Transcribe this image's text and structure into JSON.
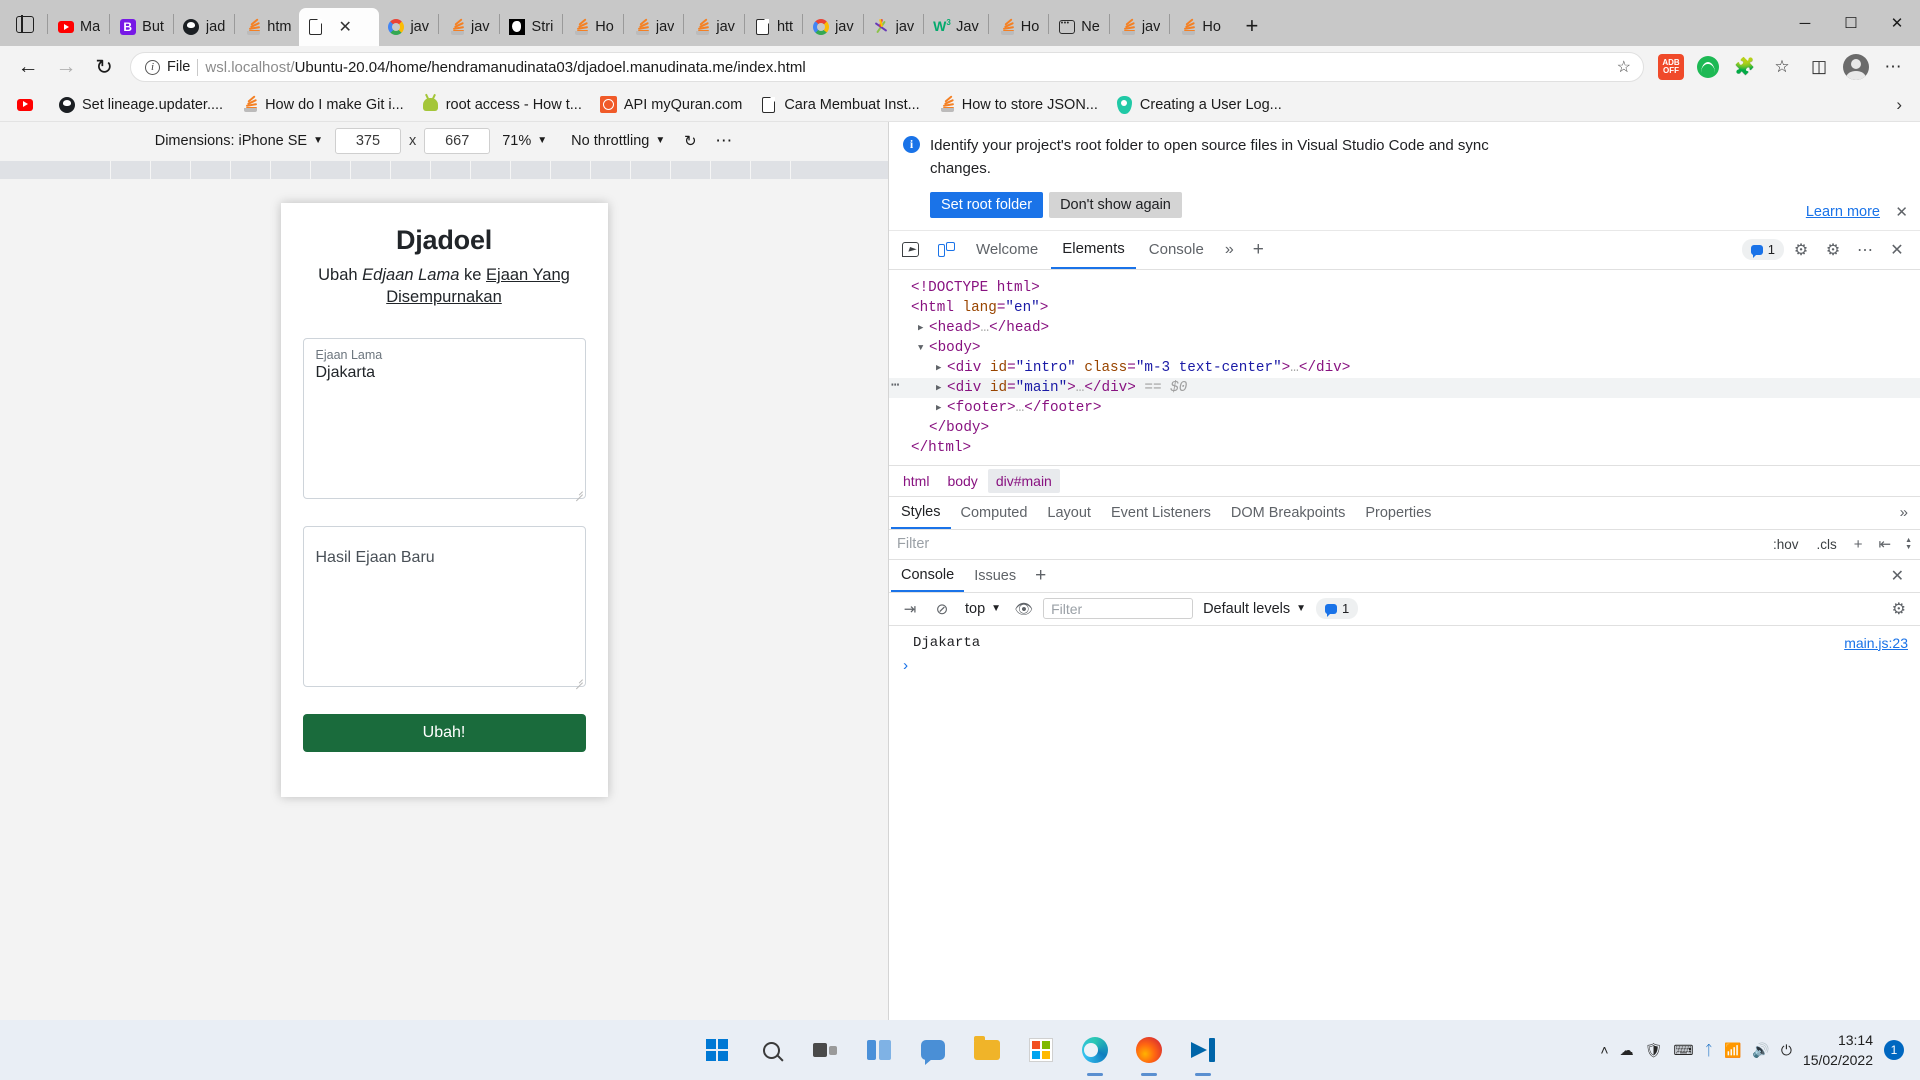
{
  "browser": {
    "sidebar_icon": "sidebar-icon",
    "tabs": [
      {
        "label": "Ma",
        "icon": "youtube-icon",
        "active": false
      },
      {
        "label": "But",
        "icon": "b-purple-icon",
        "active": false
      },
      {
        "label": "jad",
        "icon": "github-icon",
        "active": false
      },
      {
        "label": "htm",
        "icon": "stackoverflow-icon",
        "active": false
      },
      {
        "label": "",
        "icon": "document-icon",
        "active": true
      },
      {
        "label": "jav",
        "icon": "google-icon",
        "active": false
      },
      {
        "label": "jav",
        "icon": "stackoverflow-icon",
        "active": false
      },
      {
        "label": "Stri",
        "icon": "stripe-black-icon",
        "active": false
      },
      {
        "label": "Ho",
        "icon": "stackoverflow-icon",
        "active": false
      },
      {
        "label": "jav",
        "icon": "stackoverflow-icon",
        "active": false
      },
      {
        "label": "jav",
        "icon": "stackoverflow-icon",
        "active": false
      },
      {
        "label": "htt",
        "icon": "document-icon",
        "active": false
      },
      {
        "label": "jav",
        "icon": "google-icon",
        "active": false
      },
      {
        "label": "jav",
        "icon": "jsfiddle-icon",
        "active": false
      },
      {
        "label": "Jav",
        "icon": "w3schools-icon",
        "active": false
      },
      {
        "label": "Ho",
        "icon": "stackoverflow-icon",
        "active": false
      },
      {
        "label": "Ne",
        "icon": "news-icon",
        "active": false
      },
      {
        "label": "jav",
        "icon": "stackoverflow-icon",
        "active": false
      },
      {
        "label": "Ho",
        "icon": "stackoverflow-icon",
        "active": false
      }
    ],
    "new_tab_label": "+",
    "window_controls": {
      "minimize": "─",
      "maximize": "☐",
      "close": "✕"
    },
    "nav": {
      "back": "←",
      "forward": "→",
      "refresh": "↻"
    },
    "omnibox": {
      "scheme_label": "File",
      "url_prefix": "wsl.localhost/",
      "url_highlight": "Ubuntu-20.04/home/hendramanudinata03/djadoel.manudinata.me/index.html",
      "full_url": "wsl.localhost/Ubuntu-20.04/home/hendramanudinata03/djadoel.manudinata.me/index.html",
      "favorite_icon": "star-add-icon"
    },
    "toolbar_right": [
      {
        "name": "adblock-icon",
        "label": "OFF"
      },
      {
        "name": "spotify-icon"
      },
      {
        "name": "extensions-icon"
      },
      {
        "name": "favorites-icon"
      },
      {
        "name": "collections-icon"
      },
      {
        "name": "profile-avatar"
      },
      {
        "name": "settings-more-icon"
      }
    ],
    "bookmarks": [
      {
        "label": "",
        "icon": "youtube-icon"
      },
      {
        "label": "Set lineage.updater....",
        "icon": "github-icon"
      },
      {
        "label": "How do I make Git i...",
        "icon": "stackoverflow-icon"
      },
      {
        "label": "root access - How t...",
        "icon": "android-icon"
      },
      {
        "label": "API myQuran.com",
        "icon": "quran-icon"
      },
      {
        "label": "Cara Membuat Inst...",
        "icon": "document-icon"
      },
      {
        "label": "How to store JSON...",
        "icon": "stackoverflow-icon"
      },
      {
        "label": "Creating a User Log...",
        "icon": "teal-pin-icon"
      }
    ],
    "bookmarks_overflow": "›"
  },
  "device_toolbar": {
    "dimensions_label": "Dimensions: iPhone SE",
    "width": "375",
    "height": "667",
    "multiply": "x",
    "zoom": "71%",
    "throttling": "No throttling",
    "rotate_icon": "rotate-device-icon",
    "more_icon": "more-options-icon",
    "caret": "▼"
  },
  "page": {
    "title": "Djadoel",
    "subtitle_prefix": "Ubah ",
    "subtitle_italic": "Edjaan Lama",
    "subtitle_mid": " ke ",
    "subtitle_link": "Ejaan Yang Disempurnakan",
    "input_label": "Ejaan Lama",
    "input_value": "Djakarta",
    "output_placeholder": "Hasil Ejaan Baru",
    "submit_label": "Ubah!",
    "accent_color": "#1a6b3c"
  },
  "devtools": {
    "banner": {
      "text": "Identify your project's root folder to open source files in Visual Studio Code and sync changes.",
      "primary_button": "Set root folder",
      "secondary_button": "Don't show again",
      "learn_more": "Learn more",
      "close_icon": "close-icon",
      "info_icon": "info-icon"
    },
    "tabs": {
      "inspect_icon": "inspect-element-icon",
      "device_icon": "device-emulation-icon",
      "items": [
        {
          "label": "Welcome",
          "active": false
        },
        {
          "label": "Elements",
          "active": true
        },
        {
          "label": "Console",
          "active": false
        }
      ],
      "more": "»",
      "add": "+",
      "issue_count": "1",
      "settings_icon": "settings-gear-icon",
      "customize_icon": "customize-icon",
      "more_icon": "more-tools-icon",
      "close_icon": "close-devtools-icon"
    },
    "dom": [
      {
        "indent": 0,
        "arrow": "",
        "parts": [
          {
            "t": "<!DOCTYPE html>",
            "c": "tg"
          }
        ]
      },
      {
        "indent": 0,
        "arrow": "",
        "parts": [
          {
            "t": "<html ",
            "c": "tg"
          },
          {
            "t": "lang",
            "c": "at"
          },
          {
            "t": "=",
            "c": "tg"
          },
          {
            "t": "\"en\"",
            "c": "va"
          },
          {
            "t": ">",
            "c": "tg"
          }
        ]
      },
      {
        "indent": 1,
        "arrow": "▶",
        "parts": [
          {
            "t": "<head>",
            "c": "tg"
          },
          {
            "t": "…",
            "c": "gy"
          },
          {
            "t": "</head>",
            "c": "tg"
          }
        ]
      },
      {
        "indent": 1,
        "arrow": "▼",
        "parts": [
          {
            "t": "<body>",
            "c": "tg"
          }
        ]
      },
      {
        "indent": 2,
        "arrow": "▶",
        "parts": [
          {
            "t": "<div ",
            "c": "tg"
          },
          {
            "t": "id",
            "c": "at"
          },
          {
            "t": "=",
            "c": "tg"
          },
          {
            "t": "\"intro\"",
            "c": "va"
          },
          {
            "t": " class",
            "c": "at"
          },
          {
            "t": "=",
            "c": "tg"
          },
          {
            "t": "\"m-3 text-center\"",
            "c": "va"
          },
          {
            "t": ">",
            "c": "tg"
          },
          {
            "t": "…",
            "c": "gy"
          },
          {
            "t": "</div>",
            "c": "tg"
          }
        ]
      },
      {
        "indent": 2,
        "arrow": "▶",
        "selected": true,
        "dots": "⋯",
        "parts": [
          {
            "t": "<div ",
            "c": "tg"
          },
          {
            "t": "id",
            "c": "at"
          },
          {
            "t": "=",
            "c": "tg"
          },
          {
            "t": "\"main\"",
            "c": "va"
          },
          {
            "t": ">",
            "c": "tg"
          },
          {
            "t": "…",
            "c": "gy"
          },
          {
            "t": "</div>",
            "c": "tg"
          },
          {
            "t": "  == $0",
            "c": "sel-dollar"
          }
        ]
      },
      {
        "indent": 2,
        "arrow": "▶",
        "parts": [
          {
            "t": "<footer>",
            "c": "tg"
          },
          {
            "t": "…",
            "c": "gy"
          },
          {
            "t": "</footer>",
            "c": "tg"
          }
        ]
      },
      {
        "indent": 1,
        "arrow": "",
        "parts": [
          {
            "t": "</body>",
            "c": "tg"
          }
        ]
      },
      {
        "indent": 0,
        "arrow": "",
        "parts": [
          {
            "t": "</html>",
            "c": "tg"
          }
        ]
      }
    ],
    "breadcrumb": [
      {
        "label": "html",
        "active": false
      },
      {
        "label": "body",
        "active": false
      },
      {
        "label": "div#main",
        "active": true
      }
    ],
    "styles_tabs": [
      {
        "label": "Styles",
        "active": true
      },
      {
        "label": "Computed",
        "active": false
      },
      {
        "label": "Layout",
        "active": false
      },
      {
        "label": "Event Listeners",
        "active": false
      },
      {
        "label": "DOM Breakpoints",
        "active": false
      },
      {
        "label": "Properties",
        "active": false
      }
    ],
    "styles_more": "»",
    "styles_filter": {
      "placeholder": "Filter",
      "hov": ":hov",
      "cls": ".cls",
      "new_rule": "+",
      "toggle_icon": "toggle-element-state-icon"
    },
    "console_tabs": [
      {
        "label": "Console",
        "active": true
      },
      {
        "label": "Issues",
        "active": false
      }
    ],
    "console_add": "+",
    "console_close_icon": "close-icon",
    "console_toolbar": {
      "sidebar_icon": "console-sidebar-icon",
      "clear_icon": "clear-console-icon",
      "context": "top",
      "eye_icon": "live-expression-icon",
      "filter_placeholder": "Filter",
      "levels": "Default levels",
      "issue_count": "1",
      "settings_icon": "console-settings-icon",
      "caret": "▼"
    },
    "console_output": [
      {
        "message": "Djakarta",
        "source": "main.js:23"
      }
    ],
    "console_prompt": "›"
  },
  "taskbar": {
    "apps": [
      {
        "name": "start-button",
        "running": false
      },
      {
        "name": "search-button",
        "running": false
      },
      {
        "name": "task-view-button",
        "running": false
      },
      {
        "name": "widgets-button",
        "running": false
      },
      {
        "name": "chat-button",
        "running": false
      },
      {
        "name": "file-explorer",
        "running": false
      },
      {
        "name": "microsoft-store",
        "running": false
      },
      {
        "name": "microsoft-edge",
        "running": true
      },
      {
        "name": "firefox",
        "running": true
      },
      {
        "name": "visual-studio-code",
        "running": true
      }
    ],
    "tray": [
      "show-hidden-icons",
      "onedrive-icon",
      "security-icon",
      "keyboard-icon",
      "bluetooth-icon",
      "wifi-icon",
      "volume-icon",
      "battery-icon"
    ],
    "chevron": "˄",
    "time": "13:14",
    "date": "15/02/2022",
    "notification_count": "1"
  }
}
